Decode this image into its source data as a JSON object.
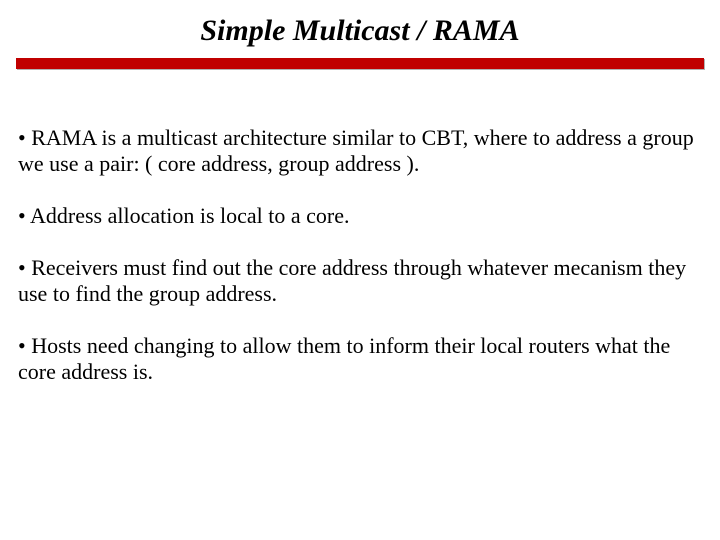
{
  "title": "Simple Multicast / RAMA",
  "bullets": [
    "RAMA is a multicast architecture similar to CBT, where to address a group we use a pair:  ( core address, group address ).",
    "Address allocation is local to a core.",
    "Receivers must find out the core address through whatever mecanism they use to find the group address.",
    "Hosts need changing to allow them to inform their local routers what the core address is."
  ]
}
